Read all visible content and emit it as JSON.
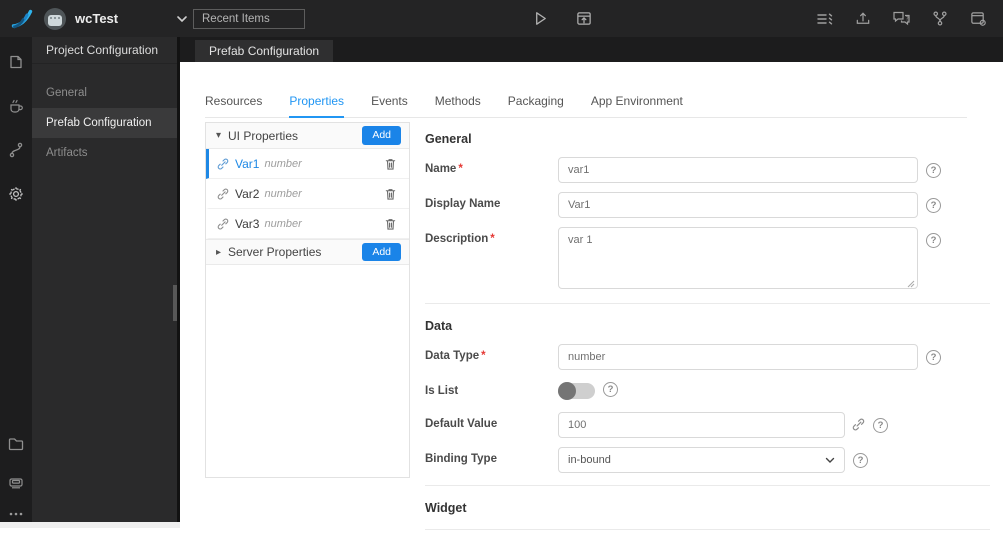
{
  "ui": {
    "required_mark": "*",
    "help_glyph": "?",
    "caret_down": "▾",
    "caret_right": "▸"
  },
  "topbar": {
    "project_name": "wcTest",
    "recent_items": "Recent Items"
  },
  "sidebar": {
    "title": "Project Configuration",
    "items": [
      {
        "label": "General"
      },
      {
        "label": "Prefab Configuration"
      },
      {
        "label": "Artifacts"
      }
    ],
    "active": "Prefab Configuration"
  },
  "document_tab": "Prefab Configuration",
  "tabs": {
    "items": [
      "Resources",
      "Properties",
      "Events",
      "Methods",
      "Packaging",
      "App Environment"
    ],
    "active": "Properties"
  },
  "panel": {
    "groups": [
      {
        "label": "UI Properties",
        "add_label": "Add",
        "expanded": true,
        "items": [
          {
            "name": "Var1",
            "type": "number",
            "selected": true
          },
          {
            "name": "Var2",
            "type": "number",
            "selected": false
          },
          {
            "name": "Var3",
            "type": "number",
            "selected": false
          }
        ]
      },
      {
        "label": "Server Properties",
        "add_label": "Add",
        "expanded": false,
        "items": []
      }
    ]
  },
  "form": {
    "general": {
      "title": "General",
      "name": {
        "label": "Name",
        "required": true,
        "value": "var1"
      },
      "display_name": {
        "label": "Display Name",
        "value": "Var1"
      },
      "description": {
        "label": "Description",
        "required": true,
        "value": "var 1"
      }
    },
    "data": {
      "title": "Data",
      "data_type": {
        "label": "Data Type",
        "required": true,
        "value": "number"
      },
      "is_list": {
        "label": "Is List",
        "enabled": false
      },
      "default_value": {
        "label": "Default Value",
        "value": "100"
      },
      "binding_type": {
        "label": "Binding Type",
        "value": "in-bound"
      }
    },
    "widget": {
      "title": "Widget"
    }
  },
  "colors": {
    "accent": "#1a84e8",
    "tab_active": "#2196f3",
    "required": "#e53935"
  }
}
